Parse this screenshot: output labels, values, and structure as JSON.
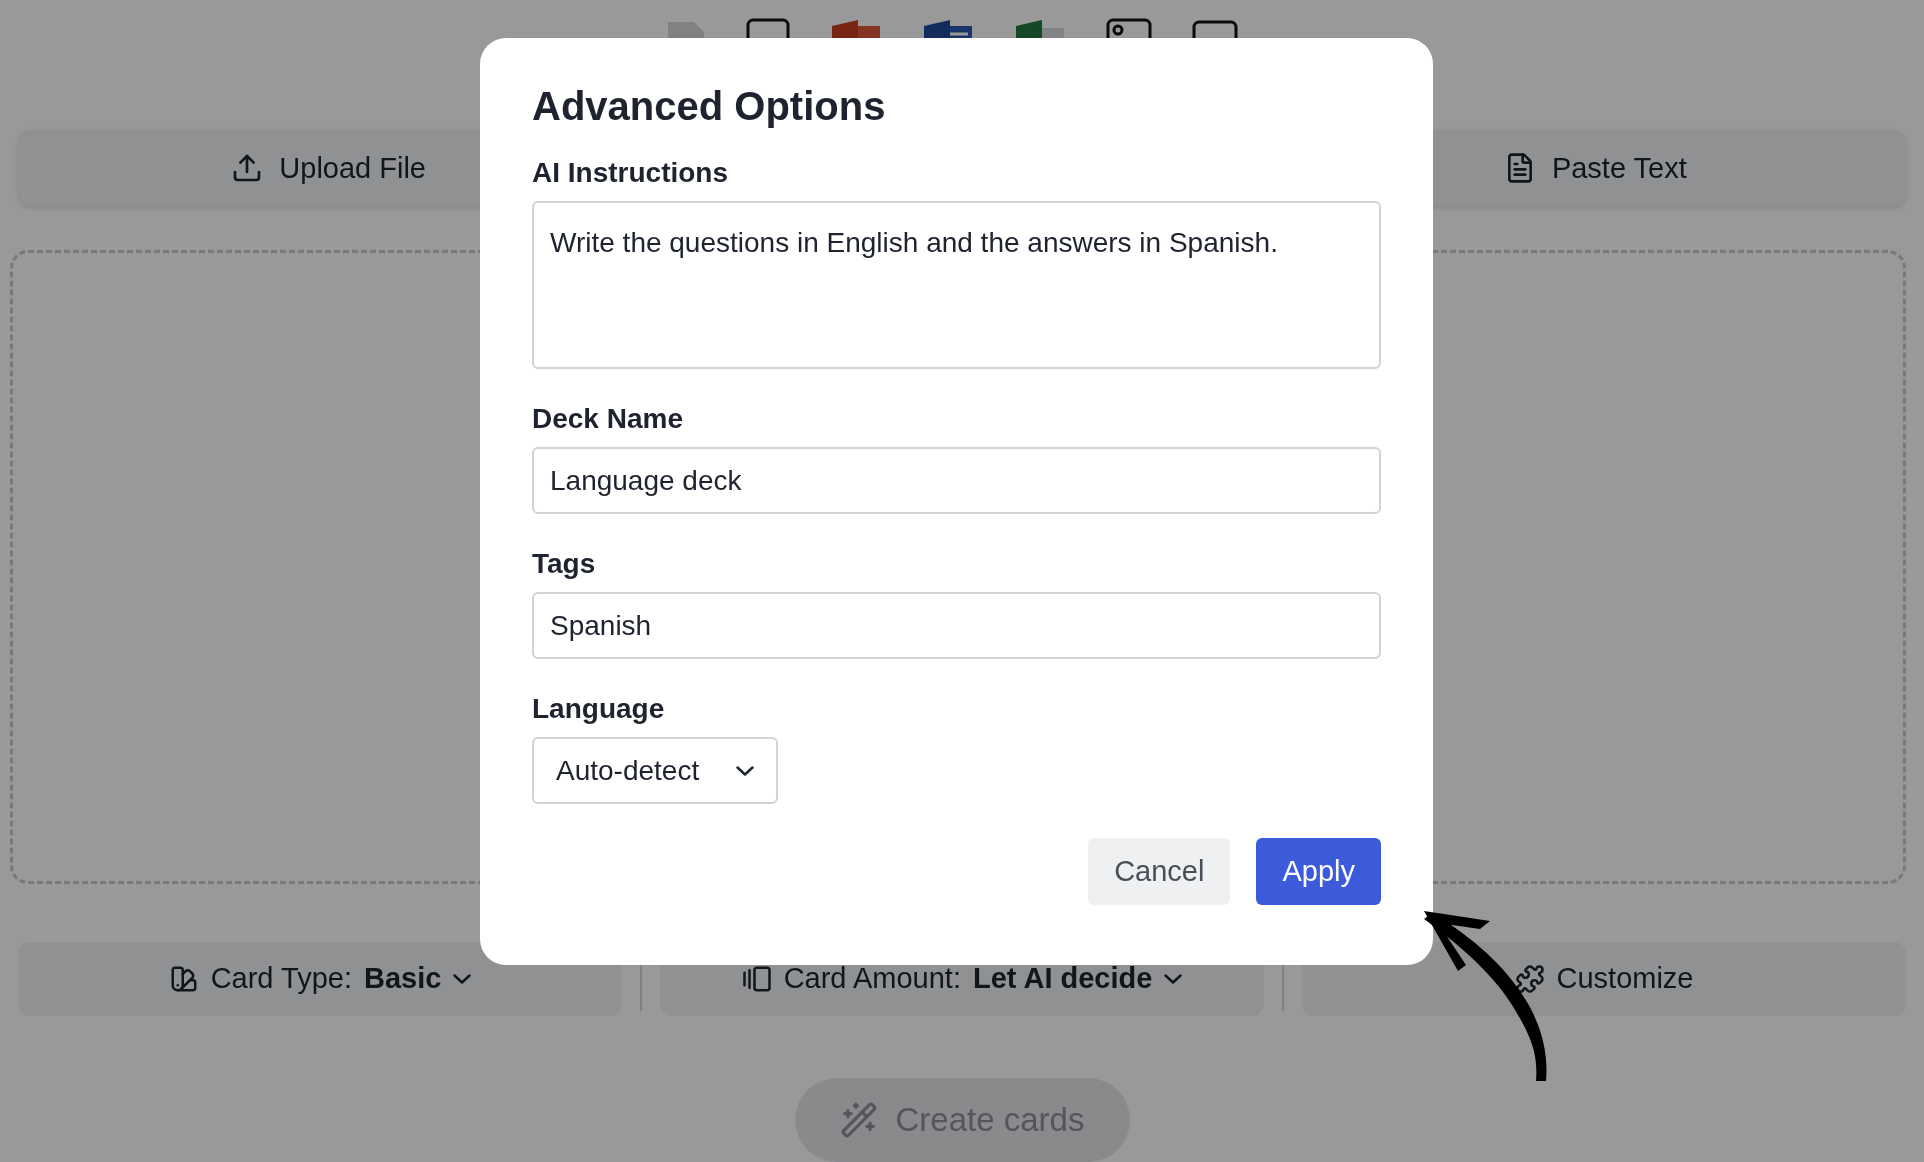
{
  "source_tabs": [
    {
      "kind": "upload",
      "label": "Upload File"
    },
    {
      "kind": "paste",
      "label": "Paste Text"
    }
  ],
  "settings_bar": [
    {
      "kind": "card-type",
      "label": "Card Type:",
      "value": "Basic"
    },
    {
      "kind": "card-amount",
      "label": "Card Amount:",
      "value": "Let AI decide"
    },
    {
      "kind": "customize",
      "label": "Customize"
    }
  ],
  "create_button": {
    "label": "Create cards"
  },
  "dialog": {
    "title": "Advanced Options",
    "fields": [
      {
        "kind": "textarea",
        "label": "AI Instructions",
        "value": "Write the questions in English and the answers in Spanish."
      },
      {
        "kind": "input",
        "label": "Deck Name",
        "value": "Language deck"
      },
      {
        "kind": "input",
        "label": "Tags",
        "value": "Spanish"
      },
      {
        "kind": "select",
        "label": "Language",
        "value": "Auto-detect"
      }
    ],
    "buttons": [
      {
        "kind": "secondary",
        "label": "Cancel"
      },
      {
        "kind": "primary",
        "label": "Apply"
      }
    ]
  }
}
